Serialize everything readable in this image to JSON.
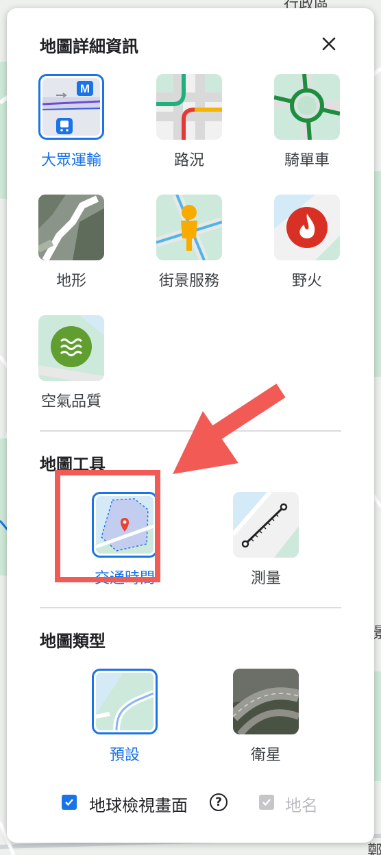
{
  "panel": {
    "details_title": "地圖詳細資訊",
    "close_symbol": "✕",
    "details": [
      {
        "label": "大眾運輸",
        "icon": "transit-icon",
        "selected": true
      },
      {
        "label": "路況",
        "icon": "traffic-icon",
        "selected": false
      },
      {
        "label": "騎單車",
        "icon": "biking-icon",
        "selected": false
      },
      {
        "label": "地形",
        "icon": "terrain-icon",
        "selected": false
      },
      {
        "label": "街景服務",
        "icon": "street-view-icon",
        "selected": false
      },
      {
        "label": "野火",
        "icon": "wildfire-icon",
        "selected": false
      },
      {
        "label": "空氣品質",
        "icon": "air-quality-icon",
        "selected": false
      }
    ],
    "tools_title": "地圖工具",
    "tools": [
      {
        "label": "交通時間",
        "icon": "travel-time-icon",
        "selected": true
      },
      {
        "label": "測量",
        "icon": "measure-icon",
        "selected": false
      }
    ],
    "types_title": "地圖類型",
    "types": [
      {
        "label": "預設",
        "icon": "default-map-icon",
        "selected": true
      },
      {
        "label": "衛星",
        "icon": "satellite-icon",
        "selected": false
      }
    ],
    "globe_view": {
      "label": "地球檢視畫面",
      "checked": true
    },
    "help_symbol": "?",
    "labels_toggle": {
      "label": "地名",
      "checked": true,
      "disabled": true
    }
  },
  "background": {
    "top_fragment": "行政區",
    "right_fragment": "景",
    "bottom_fragment": "鄭"
  },
  "colors": {
    "accent": "#1a73e8",
    "highlight": "#f25b55",
    "text": "#202124",
    "disabled": "#b9bcc0"
  }
}
